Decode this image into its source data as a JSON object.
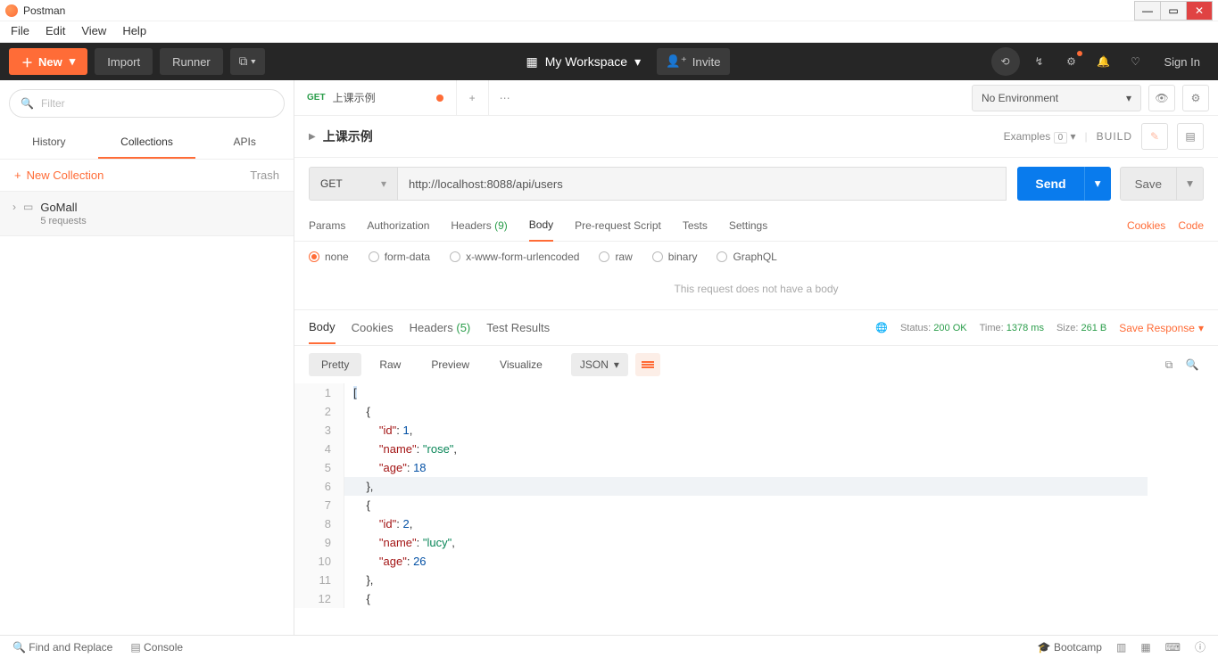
{
  "window": {
    "title": "Postman"
  },
  "menubar": [
    "File",
    "Edit",
    "View",
    "Help"
  ],
  "toolbar": {
    "new": "New",
    "import": "Import",
    "runner": "Runner",
    "workspace": "My Workspace",
    "invite": "Invite",
    "signin": "Sign In"
  },
  "sidebar": {
    "filter_placeholder": "Filter",
    "tabs": [
      "History",
      "Collections",
      "APIs"
    ],
    "new_collection": "New Collection",
    "trash": "Trash",
    "collection": {
      "name": "GoMall",
      "sub": "5 requests"
    }
  },
  "tabs": {
    "request": {
      "method": "GET",
      "name": "上课示例"
    }
  },
  "env": {
    "label": "No Environment"
  },
  "titlebar2": {
    "title": "上课示例",
    "examples": "Examples",
    "examples_count": "0",
    "build": "BUILD"
  },
  "url": {
    "method": "GET",
    "value": "http://localhost:8088/api/users",
    "send": "Send",
    "save": "Save"
  },
  "reqTabs": {
    "params": "Params",
    "auth": "Authorization",
    "headers": "Headers",
    "headers_count": "(9)",
    "body": "Body",
    "prereq": "Pre-request Script",
    "tests": "Tests",
    "settings": "Settings",
    "cookies": "Cookies",
    "code": "Code"
  },
  "bodyTypes": [
    "none",
    "form-data",
    "x-www-form-urlencoded",
    "raw",
    "binary",
    "GraphQL"
  ],
  "noBody": "This request does not have a body",
  "respTabs": {
    "body": "Body",
    "cookies": "Cookies",
    "headers": "Headers",
    "headers_count": "(5)",
    "tests": "Test Results"
  },
  "respMeta": {
    "status_label": "Status:",
    "status": "200 OK",
    "time_label": "Time:",
    "time": "1378 ms",
    "size_label": "Size:",
    "size": "261 B",
    "save": "Save Response"
  },
  "viewOpts": {
    "pretty": "Pretty",
    "raw": "Raw",
    "preview": "Preview",
    "visualize": "Visualize",
    "format": "JSON"
  },
  "response_body": [
    {
      "id": 1,
      "name": "rose",
      "age": 18
    },
    {
      "id": 2,
      "name": "lucy",
      "age": 26
    }
  ],
  "footer": {
    "find": "Find and Replace",
    "console": "Console",
    "bootcamp": "Bootcamp"
  }
}
